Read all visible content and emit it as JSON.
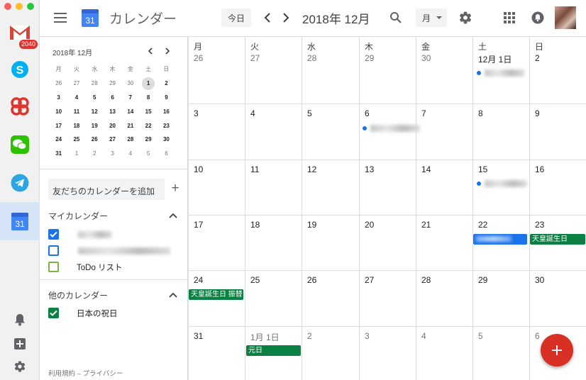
{
  "dock": {
    "gmail_badge": "2040",
    "calendar_icon_day": "31"
  },
  "header": {
    "logo_day": "31",
    "title": "カレンダー",
    "today_label": "今日",
    "month_title": "2018年 12月",
    "view_label": "月"
  },
  "sidebar": {
    "mini_title": "2018年 12月",
    "weekdays": [
      "月",
      "火",
      "水",
      "木",
      "金",
      "土",
      "日"
    ],
    "weeks": [
      [
        [
          "26",
          0
        ],
        [
          "27",
          0
        ],
        [
          "28",
          0
        ],
        [
          "29",
          0
        ],
        [
          "30",
          0
        ],
        [
          "1",
          2
        ],
        [
          "2",
          1
        ]
      ],
      [
        [
          "3",
          1
        ],
        [
          "4",
          1
        ],
        [
          "5",
          1
        ],
        [
          "6",
          1
        ],
        [
          "7",
          1
        ],
        [
          "8",
          1
        ],
        [
          "9",
          1
        ]
      ],
      [
        [
          "10",
          1
        ],
        [
          "11",
          1
        ],
        [
          "12",
          1
        ],
        [
          "13",
          1
        ],
        [
          "14",
          1
        ],
        [
          "15",
          1
        ],
        [
          "16",
          1
        ]
      ],
      [
        [
          "17",
          1
        ],
        [
          "18",
          1
        ],
        [
          "19",
          1
        ],
        [
          "20",
          1
        ],
        [
          "21",
          1
        ],
        [
          "22",
          1
        ],
        [
          "23",
          1
        ]
      ],
      [
        [
          "24",
          1
        ],
        [
          "25",
          1
        ],
        [
          "26",
          1
        ],
        [
          "27",
          1
        ],
        [
          "28",
          1
        ],
        [
          "29",
          1
        ],
        [
          "30",
          1
        ]
      ],
      [
        [
          "31",
          1
        ],
        [
          "1",
          0
        ],
        [
          "2",
          0
        ],
        [
          "3",
          0
        ],
        [
          "4",
          0
        ],
        [
          "5",
          0
        ],
        [
          "6",
          0
        ]
      ]
    ],
    "add_friend_placeholder": "友だちのカレンダーを追加",
    "add_friend_plus": "+",
    "my_calendars_title": "マイカレンダー",
    "my_calendars": [
      {
        "label": "",
        "checked": true,
        "color": "#1a73e8"
      },
      {
        "label": "",
        "checked": false,
        "color": "#1a73e8"
      },
      {
        "label": "ToDo リスト",
        "checked": false,
        "color": "#7cb342"
      }
    ],
    "other_calendars_title": "他のカレンダー",
    "other_calendars": [
      {
        "label": "日本の祝日",
        "checked": true,
        "color": "#0b8043"
      }
    ],
    "footer": "利用規約 – プライバシー"
  },
  "grid": {
    "weekdays": [
      "月",
      "火",
      "水",
      "木",
      "金",
      "土",
      "日"
    ],
    "cells": [
      [
        "26",
        "27",
        "28",
        "29",
        "30",
        "12月 1日",
        "2"
      ],
      [
        "3",
        "4",
        "5",
        "6",
        "7",
        "8",
        "9"
      ],
      [
        "10",
        "11",
        "12",
        "13",
        "14",
        "15",
        "16"
      ],
      [
        "17",
        "18",
        "19",
        "20",
        "21",
        "22",
        "23"
      ],
      [
        "24",
        "25",
        "26",
        "27",
        "28",
        "29",
        "30"
      ],
      [
        "31",
        "1月 1日",
        "2",
        "3",
        "4",
        "5",
        "6"
      ]
    ],
    "events": {
      "holiday_emperor": "天皇誕生日",
      "holiday_emperor_sub": "天皇誕生日 振替",
      "new_year": "元日"
    },
    "colors": {
      "holiday": "#0b8043",
      "event_blue": "#1a73e8",
      "fab": "#d93025"
    }
  },
  "fab_label": "+"
}
